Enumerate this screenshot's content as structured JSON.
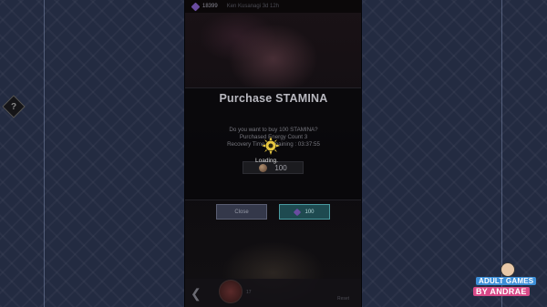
{
  "topbar": {
    "gem_count": "18399",
    "faded_text": "Ken Kusanagi  3d 12h"
  },
  "dialog": {
    "title": "Purchase STAMINA",
    "help_symbol": "?",
    "question": "Do you want to buy 100 STAMINA?",
    "purchased_count": "Purchased Energy Count 3",
    "recovery_time": "Recovery Time Remaining : 03:37:55",
    "loading_text": "Loading.",
    "cost_amount": "100",
    "close_label": "Close",
    "buy_label": "100"
  },
  "bottombar": {
    "left_label": "17",
    "right_label": "Reset"
  },
  "watermark": {
    "line1": "ADULT GAMES",
    "line2": "BY ANDRAE"
  },
  "colors": {
    "accent_teal": "#4a9aa0",
    "gem_purple": "#6a4ca0",
    "watermark_blue": "#3d8fd8",
    "watermark_pink": "#d84a88"
  }
}
